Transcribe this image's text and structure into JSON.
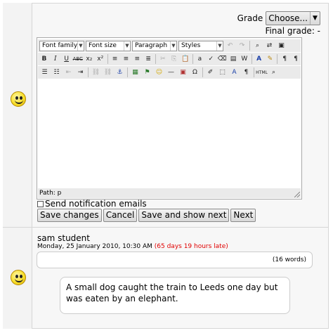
{
  "grade": {
    "label": "Grade",
    "selected": "Choose...",
    "final_label": "Final grade: -"
  },
  "editor": {
    "font_family": "Font family",
    "font_size": "Font size",
    "format": "Paragraph",
    "styles": "Styles",
    "path": "Path: p"
  },
  "notify_label": "Send notification emails",
  "buttons": {
    "save_changes": "Save changes",
    "cancel": "Cancel",
    "save_show_next": "Save and show next",
    "next": "Next"
  },
  "submission": {
    "author": "sam student",
    "date": "Monday, 25 January 2010, 10:30 AM",
    "late": "(65 days 19 hours late)",
    "words": "(16 words)",
    "text": "A small dog caught the train to Leeds one day but was eaten by an elephant."
  },
  "colors": {
    "late": "#e00000",
    "smiley": "#f8df2a"
  },
  "icons": [
    "bold-icon",
    "italic-icon",
    "underline-icon",
    "strikethrough-icon",
    "subscript-icon",
    "superscript-icon",
    "align-left-icon",
    "align-center-icon",
    "align-right-icon",
    "justify-icon",
    "undo-icon",
    "redo-icon",
    "find-icon",
    "replace-icon",
    "bullet-list-icon",
    "numbered-list-icon",
    "outdent-icon",
    "indent-icon",
    "link-icon",
    "unlink-icon",
    "anchor-icon",
    "image-icon",
    "media-icon",
    "emoticon-icon",
    "hr-icon",
    "charmap-icon",
    "html-icon",
    "cleanup-icon",
    "fullscreen-icon"
  ]
}
